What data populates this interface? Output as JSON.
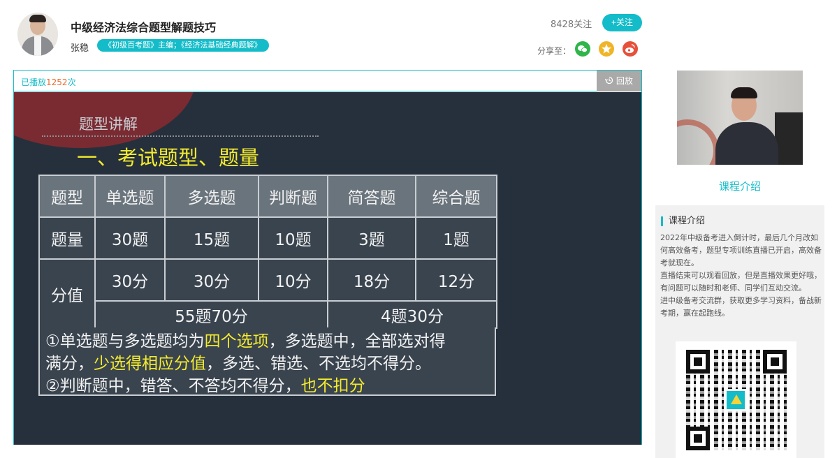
{
  "course": {
    "title": "中级经济法综合题型解题技巧",
    "teacher_name": "张稳",
    "teacher_tag": "《初级百考题》主编；《经济法基础经典题解》"
  },
  "follow": {
    "count_label": "8428关注",
    "button_label": "+关注"
  },
  "share": {
    "label": "分享至：",
    "icons": [
      "wechat-icon",
      "qzone-icon",
      "weibo-icon"
    ]
  },
  "player": {
    "play_count_prefix": "已播放",
    "play_count": "1252",
    "play_count_suffix": "次",
    "replay_label": "回放"
  },
  "slide": {
    "subtitle": "题型讲解",
    "heading": "一、考试题型、题量",
    "table": {
      "header": [
        "题型",
        "单选题",
        "多选题",
        "判断题",
        "简答题",
        "综合题"
      ],
      "count_label": "题量",
      "counts": [
        "30题",
        "15题",
        "10题",
        "3题",
        "1题"
      ],
      "score_label": "分值",
      "scores": [
        "30分",
        "30分",
        "10分",
        "18分",
        "12分"
      ],
      "subtotal_objective": "55题70分",
      "subtotal_subjective": "4题30分"
    },
    "notes": {
      "line1_a": "①单选题与多选题均为",
      "line1_hl": "四个选项",
      "line1_b": "，多选题中，全部选对得",
      "line2_a": "满分，",
      "line2_hl": "少选得相应分值",
      "line2_b": "，多选、错选、不选均不得分。",
      "line3_a": "②判断题中，错答、不答均不得分，",
      "line3_hl": "也不扣分"
    }
  },
  "sidebar": {
    "intro_link": "课程介绍",
    "intro_heading": "课程介绍",
    "intro_paragraphs": [
      "2022年中级备考进入倒计时，最后几个月改如何高效备考，题型专项训练直播已开启，高效备考就现在。",
      "直播结束可以观看回放，但是直播效果更好哦，有问题可以随时和老师、同学们互动交流。",
      "进中级备考交流群，获取更多学习资料，备战新考期，赢在起跑线。"
    ]
  },
  "colors": {
    "accent": "#14bcc9",
    "play_count_number": "#ec6a2c",
    "slide_highlight": "#f4ec2d",
    "slide_background": "#26303c"
  }
}
